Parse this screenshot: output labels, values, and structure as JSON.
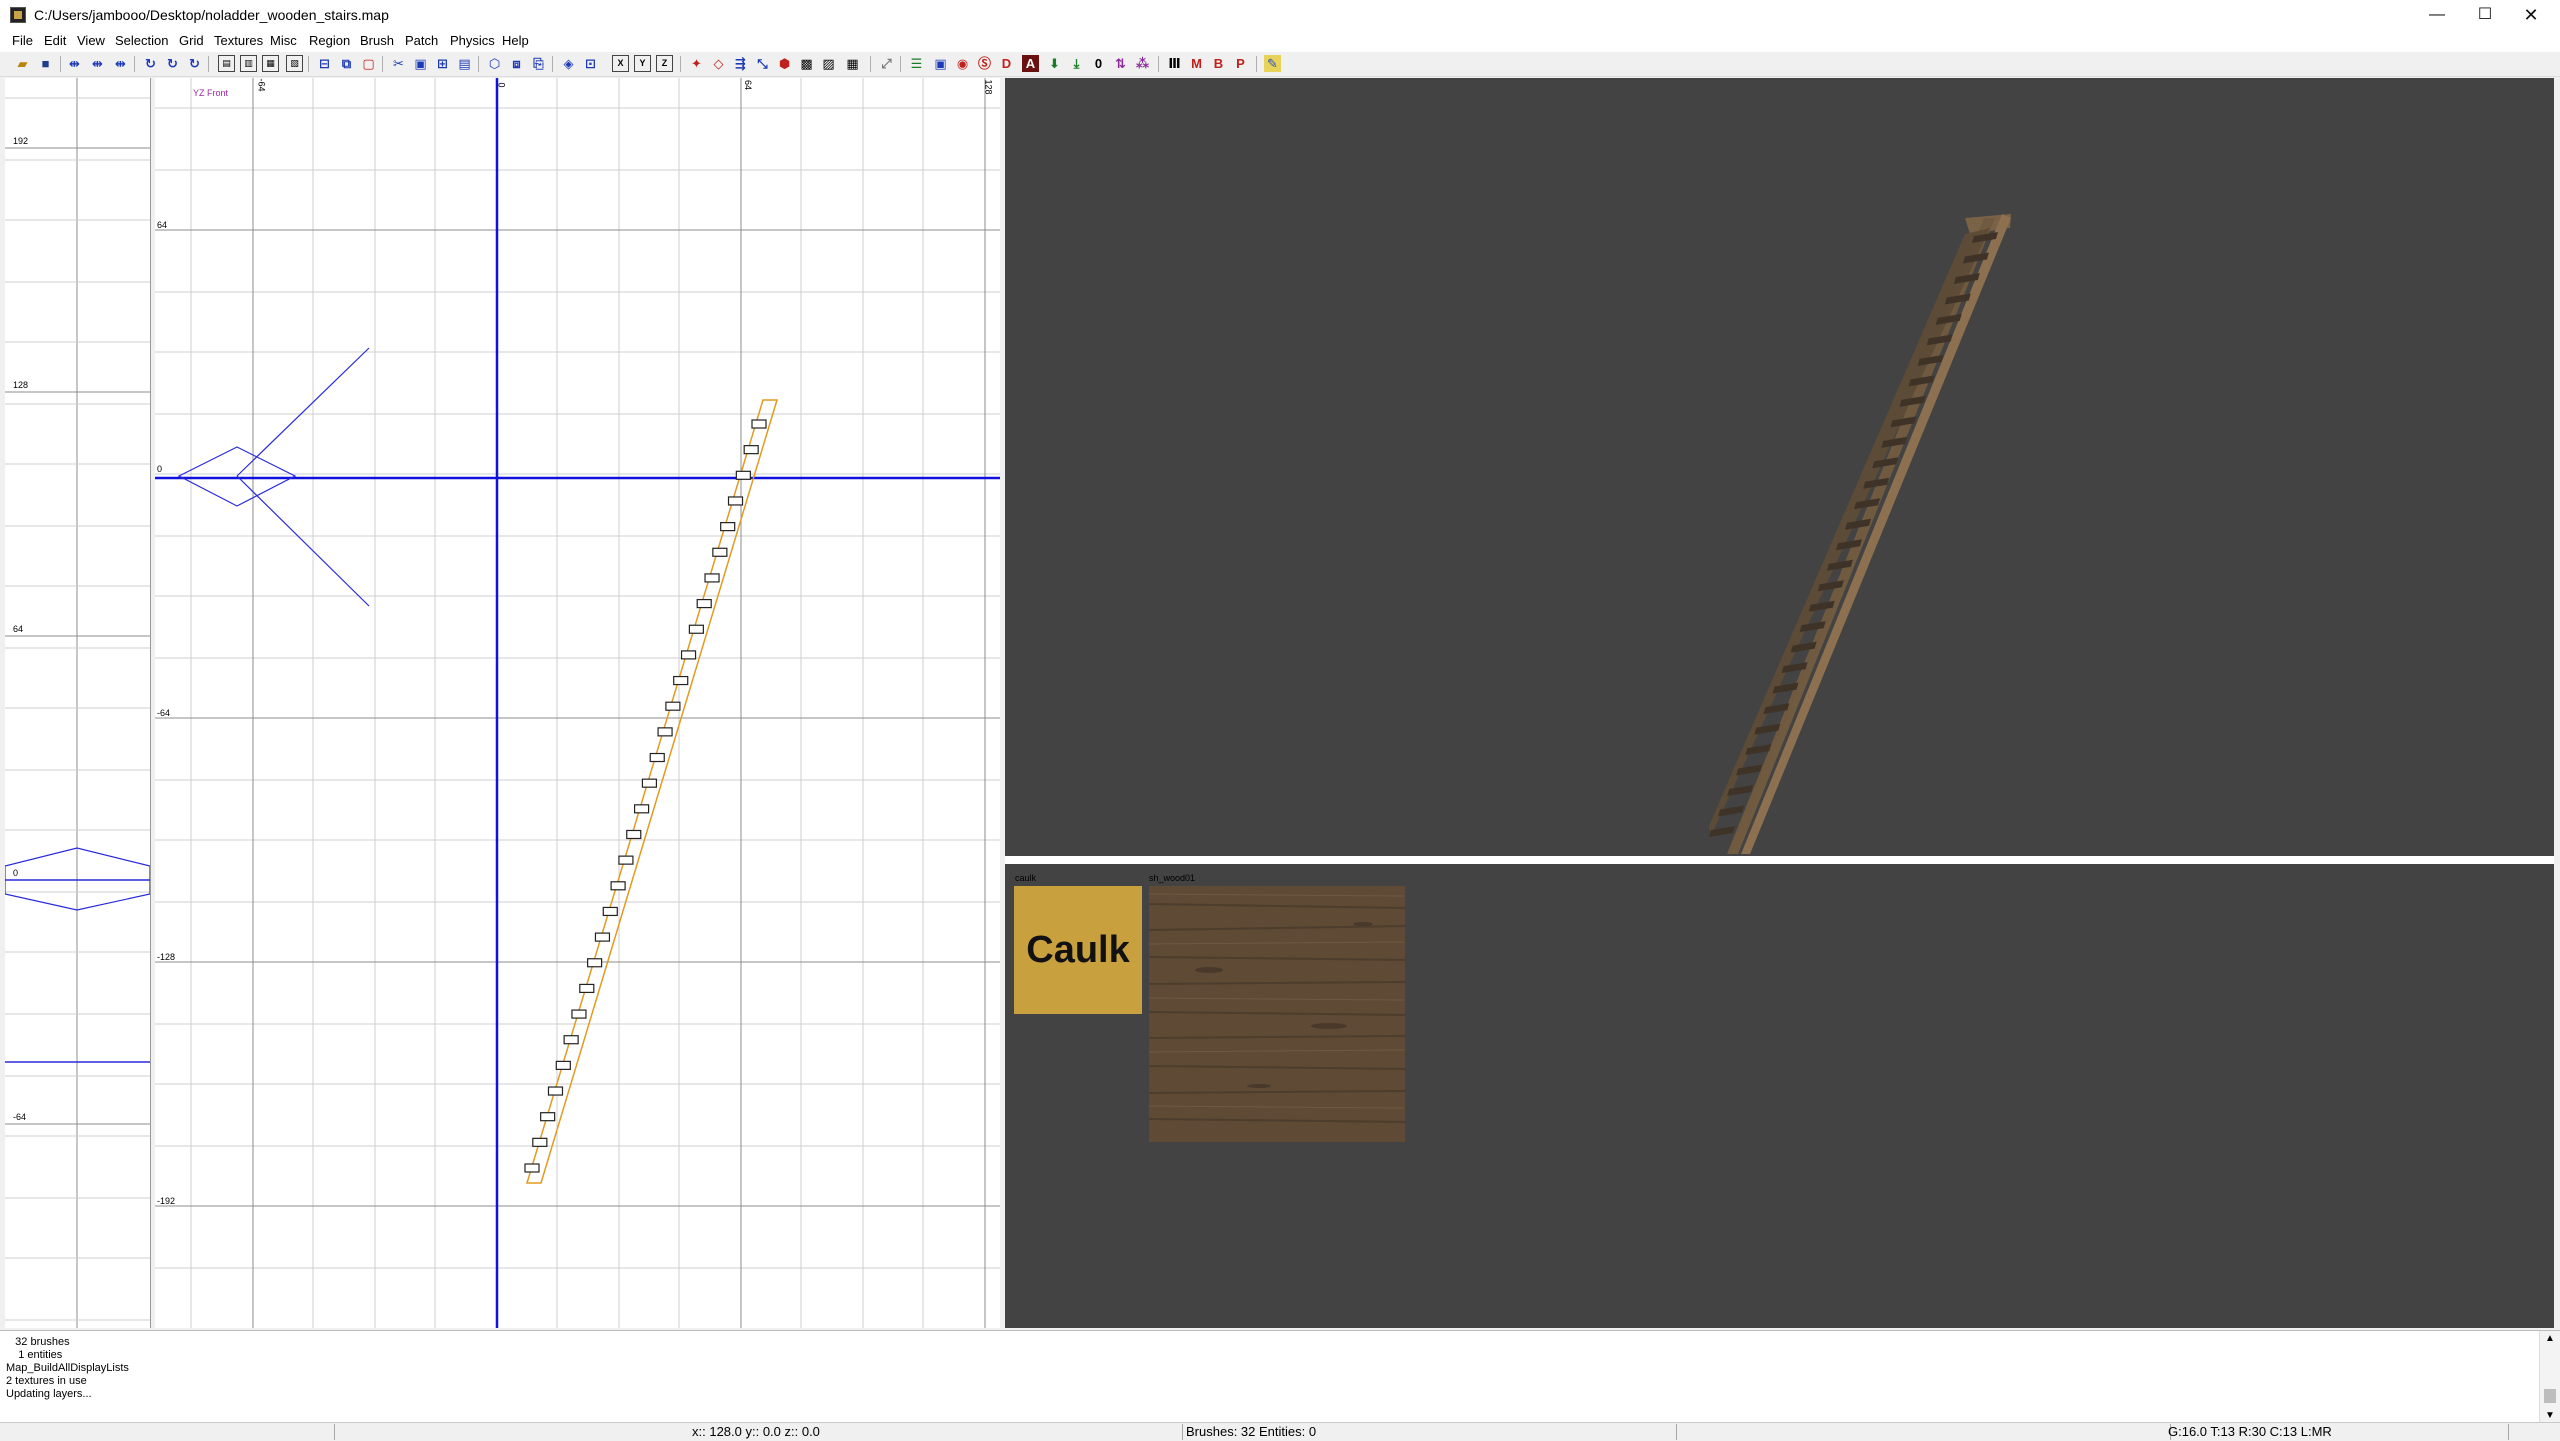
{
  "window": {
    "title": "C:/Users/jambooo/Desktop/noladder_wooden_stairs.map",
    "minimize": "—",
    "maximize": "☐",
    "close": "✕"
  },
  "menu": [
    "File",
    "Edit",
    "View",
    "Selection",
    "Grid",
    "Textures",
    "Misc",
    "Region",
    "Brush",
    "Patch",
    "Physics",
    "Help"
  ],
  "toolbar": {
    "texture_lock_label": "0",
    "vertex_badge": "D",
    "model_badge": "M",
    "brush_badge": "B",
    "patch_badge": "P",
    "entity_badge": "A"
  },
  "side_view": {
    "tick_labels": [
      "192",
      "128",
      "64",
      "0",
      "-64"
    ]
  },
  "front_view": {
    "name": "YZ Front",
    "top_ticks": [
      "-64",
      "0",
      "64",
      "128"
    ],
    "left_ticks": [
      "64",
      "0",
      "-64",
      "-128",
      "-192"
    ],
    "colors": {
      "axis": "#1111dd",
      "brush": "#e39a1f",
      "grid_minor": "#cfcfcf",
      "grid_major": "#8c8c8c"
    }
  },
  "camera_view": {
    "background": "#434343"
  },
  "texture_browser": {
    "textures": [
      {
        "name": "caulk",
        "tile_text": "Caulk",
        "color": "#c8a13e"
      },
      {
        "name": "sh_wood01",
        "color": "#5e4a35"
      }
    ]
  },
  "console": {
    "lines": [
      "   32 brushes",
      "    1 entities",
      "Map_BuildAllDisplayLists",
      "2 textures in use",
      "Updating layers..."
    ]
  },
  "status": {
    "coords": "x:: 128.0  y:: 0.0  z:: 0.0",
    "counts": "Brushes: 32 Entities: 0",
    "grid": "G:16.0 T:13 R:30 C:13 L:MR"
  }
}
